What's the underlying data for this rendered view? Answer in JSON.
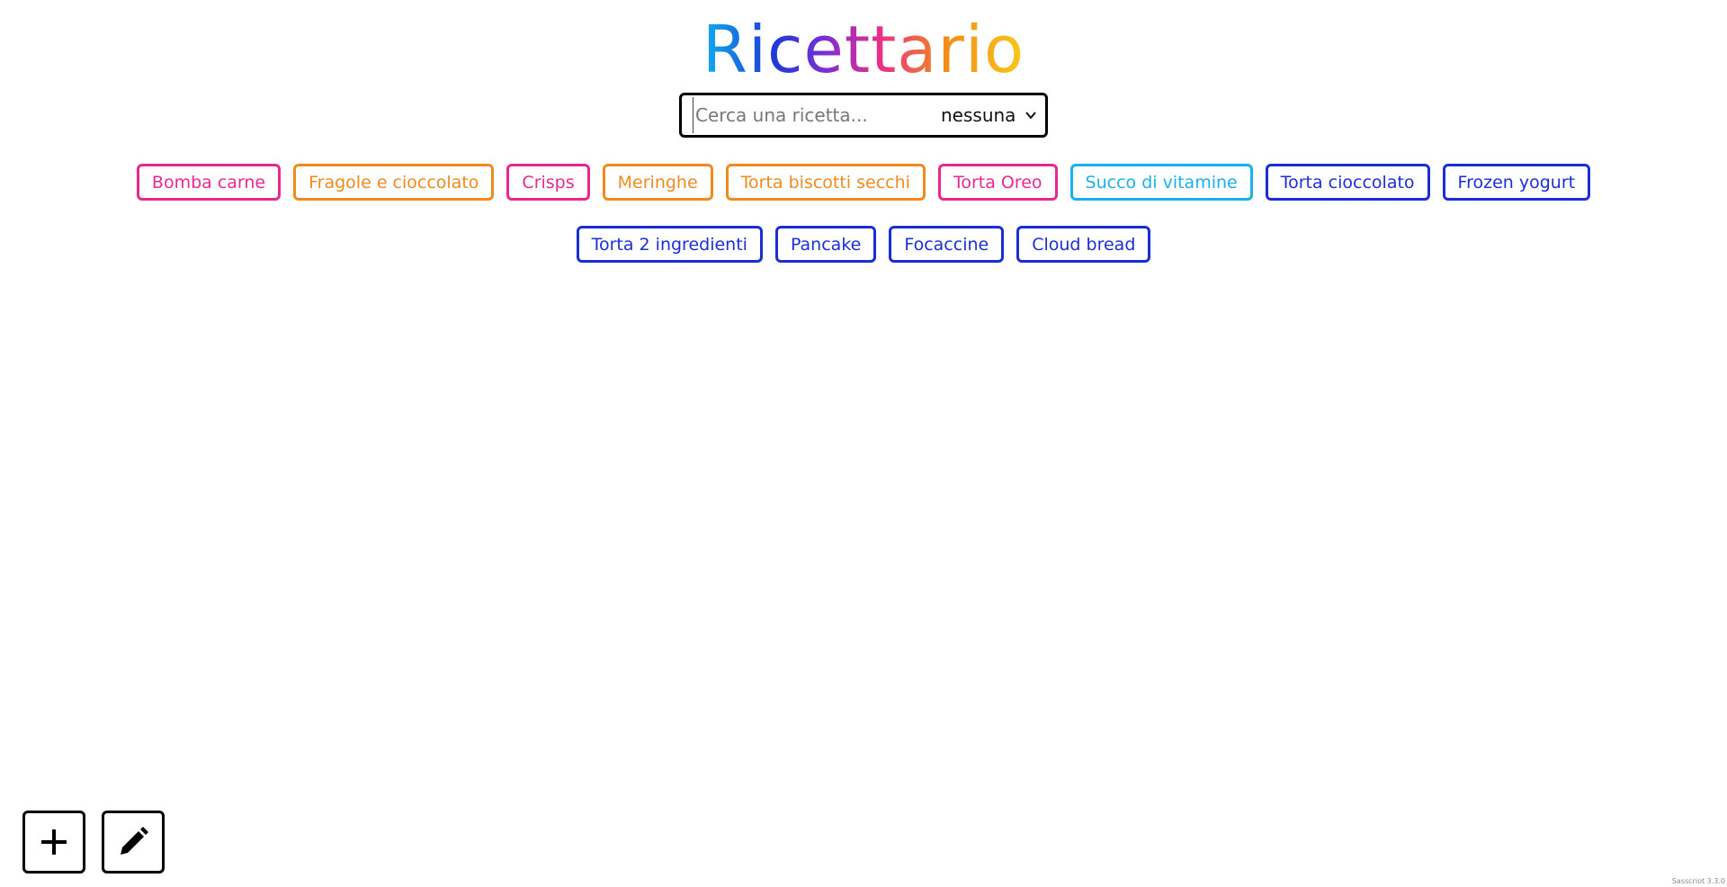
{
  "header": {
    "title": "Ricettario"
  },
  "search": {
    "placeholder": "Cerca una ricetta...",
    "value": "",
    "filter_selected": "nessuna"
  },
  "recipes": [
    {
      "label": "Bomba carne",
      "color": "#e8288f"
    },
    {
      "label": "Fragole e cioccolato",
      "color": "#f08a1c"
    },
    {
      "label": "Crisps",
      "color": "#e8288f"
    },
    {
      "label": "Meringhe",
      "color": "#f08a1c"
    },
    {
      "label": "Torta biscotti secchi",
      "color": "#f08a1c"
    },
    {
      "label": "Torta Oreo",
      "color": "#e8288f"
    },
    {
      "label": "Succo di vitamine",
      "color": "#1ab0ec"
    },
    {
      "label": "Torta cioccolato",
      "color": "#1a2ed4"
    },
    {
      "label": "Frozen yogurt",
      "color": "#1a2ed4"
    },
    {
      "label": "Torta 2 ingredienti",
      "color": "#1a2ed4"
    },
    {
      "label": "Pancake",
      "color": "#1a2ed4"
    },
    {
      "label": "Focaccine",
      "color": "#1a2ed4"
    },
    {
      "label": "Cloud bread",
      "color": "#1a2ed4"
    }
  ],
  "actions": {
    "add_icon": "plus-icon",
    "edit_icon": "pencil-icon"
  },
  "footer": {
    "version": "Sasscriot 3.3.0"
  }
}
